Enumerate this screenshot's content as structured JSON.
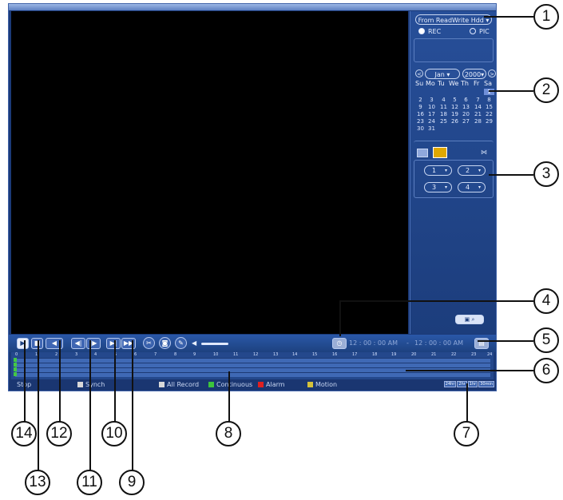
{
  "side_panel": {
    "source_select": "From ReadWrite Hdd",
    "modes": [
      {
        "label": "REC",
        "selected": true
      },
      {
        "label": "PIC",
        "selected": false
      }
    ],
    "calendar": {
      "month": "Jan",
      "year": "2000",
      "weekdays": [
        "Su",
        "Mo",
        "Tu",
        "We",
        "Th",
        "Fr",
        "Sa"
      ],
      "days": [
        "1",
        "2",
        "3",
        "4",
        "5",
        "6",
        "7",
        "8",
        "9",
        "10",
        "11",
        "12",
        "13",
        "14",
        "15",
        "16",
        "17",
        "18",
        "19",
        "20",
        "21",
        "22",
        "23",
        "24",
        "25",
        "26",
        "27",
        "28",
        "29",
        "30",
        "31"
      ],
      "highlighted_day": "1"
    },
    "channels": [
      "1",
      "2",
      "3",
      "4"
    ]
  },
  "controls": {
    "buttons": [
      {
        "name": "play",
        "glyph": "▶"
      },
      {
        "name": "stop",
        "glyph": "■"
      },
      {
        "name": "play-backward",
        "glyph": "◀"
      },
      {
        "name": "previous-frame",
        "glyph": "◀|"
      },
      {
        "name": "next-frame",
        "glyph": "|▶"
      },
      {
        "name": "slow-play",
        "glyph": "▶|"
      },
      {
        "name": "fast-forward",
        "glyph": "▶▶"
      }
    ],
    "time_start": "12 : 00 : 00 AM",
    "time_separator": "-",
    "time_end": "12 : 00 : 00 AM"
  },
  "timeline": {
    "hours": [
      "0",
      "1",
      "2",
      "3",
      "4",
      "5",
      "6",
      "7",
      "8",
      "9",
      "10",
      "11",
      "12",
      "13",
      "14",
      "15",
      "16",
      "17",
      "18",
      "19",
      "20",
      "21",
      "22",
      "23",
      "24"
    ]
  },
  "status_bar": {
    "state": "Stop",
    "synch": "Synch",
    "legend": [
      {
        "label": "All Record",
        "color": "#d8d8d8"
      },
      {
        "label": "Continuous",
        "color": "#3cc43c"
      },
      {
        "label": "Alarm",
        "color": "#e02020"
      },
      {
        "label": "Motion",
        "color": "#d4c23a"
      }
    ],
    "scales": [
      "24hr",
      "2hr",
      "1hr",
      "30min"
    ]
  },
  "callouts": [
    "1",
    "2",
    "3",
    "4",
    "5",
    "6",
    "7",
    "8",
    "9",
    "10",
    "11",
    "12",
    "13",
    "14"
  ],
  "colors": {
    "accent": "#1b3a78",
    "video_background": "#000000",
    "continuous": "#3cc43c",
    "alarm": "#e02020",
    "motion": "#d4c23a"
  }
}
